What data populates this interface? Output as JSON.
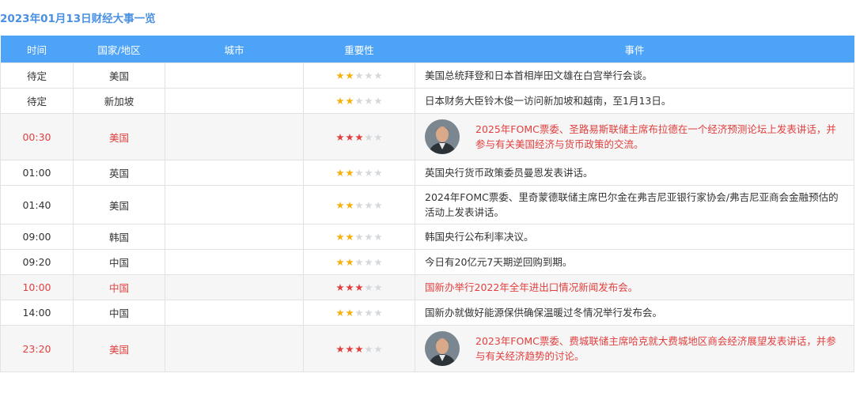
{
  "title": "2023年01月13日财经大事一览",
  "columns": [
    "时间",
    "国家/地区",
    "城市",
    "重要性",
    "事件"
  ],
  "star_colors": {
    "level2": "#f5b20c",
    "level3": "#e0403f",
    "off": "#d6d9dc"
  },
  "rows": [
    {
      "time": "待定",
      "country": "美国",
      "city": "",
      "importance": 2,
      "event": "美国总统拜登和日本首相岸田文雄在白宫举行会谈。",
      "highlight": false,
      "avatar": false
    },
    {
      "time": "待定",
      "country": "新加坡",
      "city": "",
      "importance": 2,
      "event": "日本财务大臣铃木俊一访问新加坡和越南，至1月13日。",
      "highlight": false,
      "avatar": false
    },
    {
      "time": "00:30",
      "country": "美国",
      "city": "",
      "importance": 3,
      "event": "2025年FOMC票委、圣路易斯联储主席布拉德在一个经济预测论坛上发表讲话，并参与有关美国经济与货币政策的交流。",
      "highlight": true,
      "avatar": true
    },
    {
      "time": "01:00",
      "country": "英国",
      "city": "",
      "importance": 2,
      "event": "英国央行货币政策委员曼恩发表讲话。",
      "highlight": false,
      "avatar": false
    },
    {
      "time": "01:40",
      "country": "美国",
      "city": "",
      "importance": 2,
      "event": "2024年FOMC票委、里奇蒙德联储主席巴尔金在弗吉尼亚银行家协会/弗吉尼亚商会金融预估的活动上发表讲话。",
      "highlight": false,
      "avatar": false
    },
    {
      "time": "09:00",
      "country": "韩国",
      "city": "",
      "importance": 2,
      "event": "韩国央行公布利率决议。",
      "highlight": false,
      "avatar": false
    },
    {
      "time": "09:20",
      "country": "中国",
      "city": "",
      "importance": 2,
      "event": "今日有20亿元7天期逆回购到期。",
      "highlight": false,
      "avatar": false
    },
    {
      "time": "10:00",
      "country": "中国",
      "city": "",
      "importance": 3,
      "event": "国新办举行2022年全年进出口情况新闻发布会。",
      "highlight": true,
      "avatar": false
    },
    {
      "time": "14:00",
      "country": "中国",
      "city": "",
      "importance": 2,
      "event": "国新办就做好能源保供确保温暖过冬情况举行发布会。",
      "highlight": false,
      "avatar": false
    },
    {
      "time": "23:20",
      "country": "美国",
      "city": "",
      "importance": 3,
      "event": "2023年FOMC票委、费城联储主席哈克就大费城地区商会经济展望发表讲话，并参与有关经济趋势的讨论。",
      "highlight": true,
      "avatar": true
    }
  ]
}
